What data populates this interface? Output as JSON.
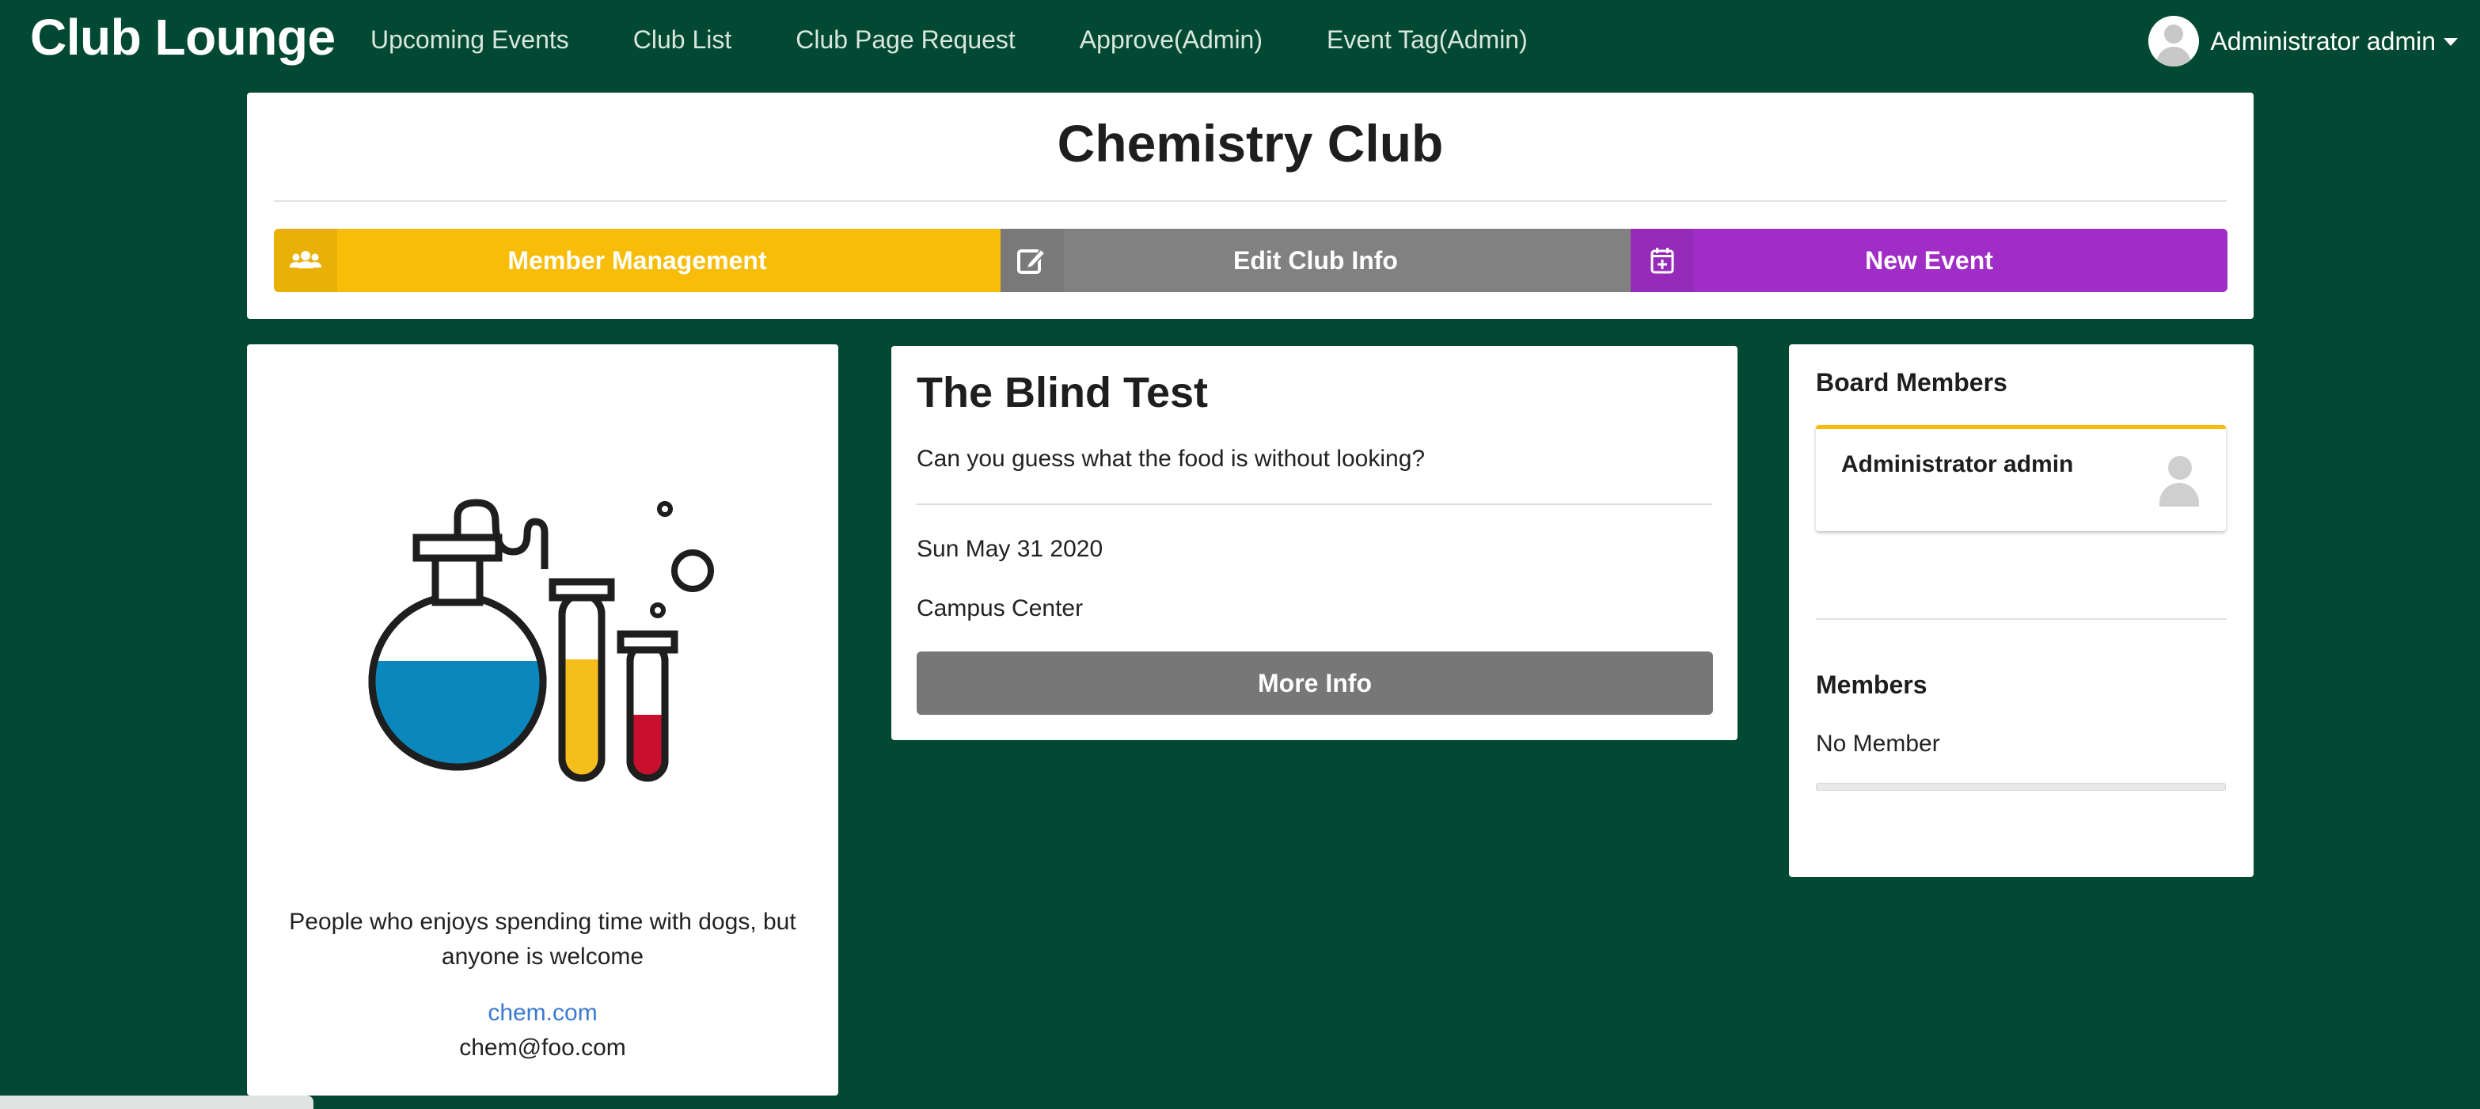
{
  "nav": {
    "brand": "Club Lounge",
    "links": [
      "Upcoming Events",
      "Club List",
      "Club Page Request",
      "Approve(Admin)",
      "Event Tag(Admin)"
    ],
    "user": "Administrator admin"
  },
  "club": {
    "title": "Chemistry Club",
    "actions": {
      "members": "Member Management",
      "edit": "Edit Club Info",
      "new_event": "New Event"
    },
    "description": "People who enjoys spending time with dogs, but anyone is welcome",
    "website": "chem.com",
    "email": "chem@foo.com"
  },
  "event": {
    "title": "The Blind Test",
    "description": "Can you guess what the food is without looking?",
    "date": "Sun May 31 2020",
    "location": "Campus Center",
    "more_label": "More Info"
  },
  "sidebar": {
    "board_title": "Board Members",
    "board_members": [
      "Administrator admin"
    ],
    "members_title": "Members",
    "no_member_text": "No Member"
  },
  "colors": {
    "background": "#024933",
    "members_button": "#f8bd08",
    "edit_button": "#818181",
    "new_event_button": "#a02ec6",
    "more_info_button": "#777777",
    "link": "#3a7bd0"
  },
  "icons": {
    "members": "users-icon",
    "edit": "edit-icon",
    "new_event": "calendar-plus-icon",
    "user": "avatar-icon"
  }
}
